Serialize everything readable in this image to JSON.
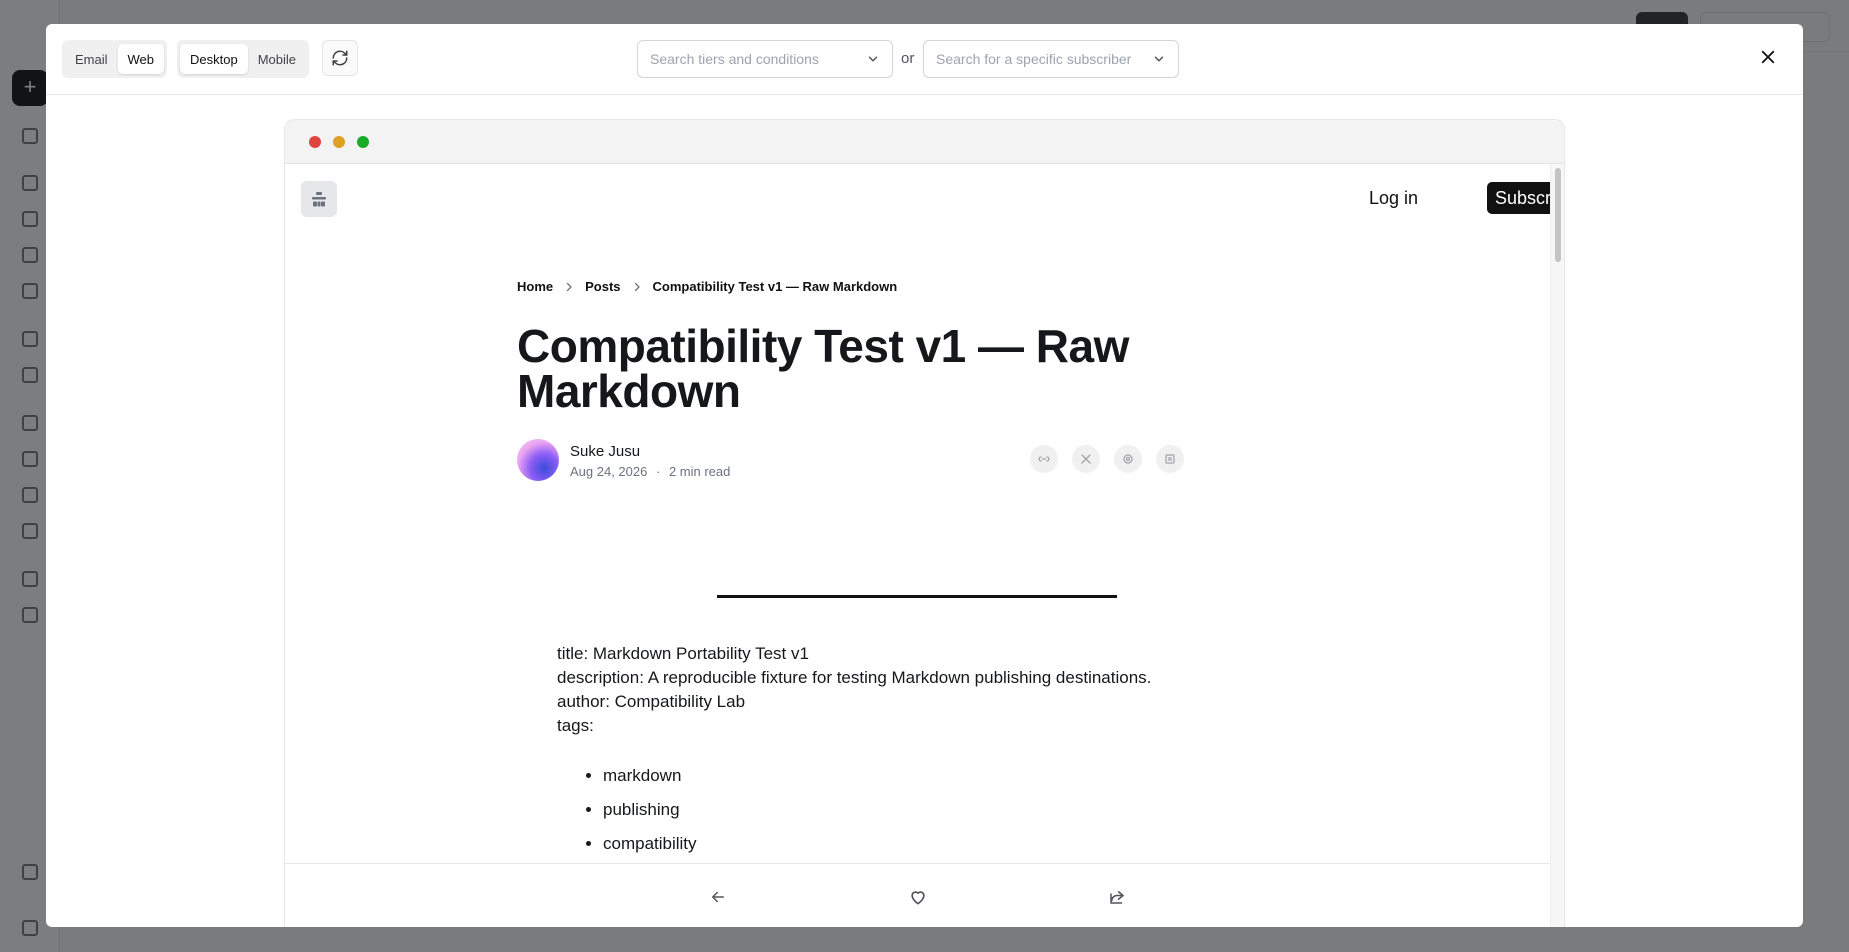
{
  "toolbar": {
    "format_tabs": [
      "Email",
      "Web"
    ],
    "device_tabs": [
      "Desktop",
      "Mobile"
    ],
    "active_format": "Web",
    "active_device": "Desktop",
    "tiers_search_placeholder": "Search tiers and conditions",
    "or_label": "or",
    "subscriber_search_placeholder": "Search for a specific subscriber"
  },
  "site": {
    "login_label": "Log in",
    "subscribe_label": "Subscribe"
  },
  "breadcrumb": {
    "home": "Home",
    "posts": "Posts",
    "current": "Compatibility Test v1 — Raw Markdown"
  },
  "post": {
    "title": "Compatibility Test v1 — Raw Markdown",
    "author": "Suke Jusu",
    "date": "Aug 24, 2026",
    "separator": "·",
    "read_time": "2 min read",
    "frontmatter": [
      "title: Markdown Portability Test v1",
      "description: A reproducible fixture for testing Markdown publishing destinations.",
      "author: Compatibility Lab",
      "tags:"
    ],
    "tags": [
      "markdown",
      "publishing",
      "compatibility"
    ]
  },
  "share_icons": [
    "link-icon",
    "x-icon",
    "threads-icon",
    "email-icon"
  ],
  "colors": {
    "accent": "#111111",
    "traffic_red": "#e0443e",
    "traffic_yellow": "#dea123",
    "traffic_green": "#1aab29"
  }
}
